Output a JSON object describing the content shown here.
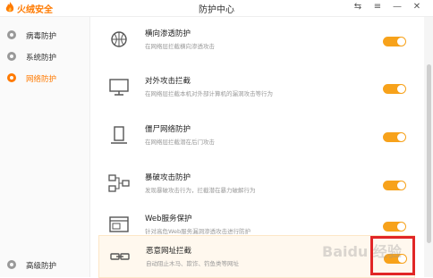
{
  "app": {
    "brand": "火绒安全",
    "title": "防护中心"
  },
  "window_controls": [
    "⇆",
    "≡",
    "—",
    "✕"
  ],
  "sidebar": {
    "items": [
      {
        "label": "病毒防护",
        "active": false
      },
      {
        "label": "系统防护",
        "active": false
      },
      {
        "label": "网络防护",
        "active": true
      }
    ],
    "bottom": {
      "label": "高级防护"
    }
  },
  "protections": [
    {
      "name": "横向渗透防护",
      "desc": "在网络层拦截横向渗透攻击",
      "enabled": true,
      "icon": "network-globe-icon"
    },
    {
      "name": "对外攻击拦截",
      "desc": "在网络层拦截本机对外部计算机的漏洞攻击等行为",
      "enabled": true,
      "icon": "monitor-icon"
    },
    {
      "name": "僵尸网络防护",
      "desc": "在网络层拦截潜在后门攻击",
      "enabled": true,
      "icon": "server-icon"
    },
    {
      "name": "暴破攻击防护",
      "desc": "发现暴破攻击行为，拦截潜在暴力破解行为",
      "enabled": true,
      "icon": "nodes-icon"
    },
    {
      "name": "Web服务保护",
      "desc": "针对高危Web服务漏洞渗透攻击进行防护",
      "enabled": true,
      "icon": "web-window-icon"
    },
    {
      "name": "恶意网址拦截",
      "desc": "自动阻止木马、欺诈、钓鱼类等网址",
      "enabled": true,
      "icon": "link-icon"
    }
  ],
  "colors": {
    "accent": "#ff7a00",
    "toggle_on": "#f7a21b",
    "highlight_box": "#e12626"
  },
  "watermark": "Baidu 经验"
}
